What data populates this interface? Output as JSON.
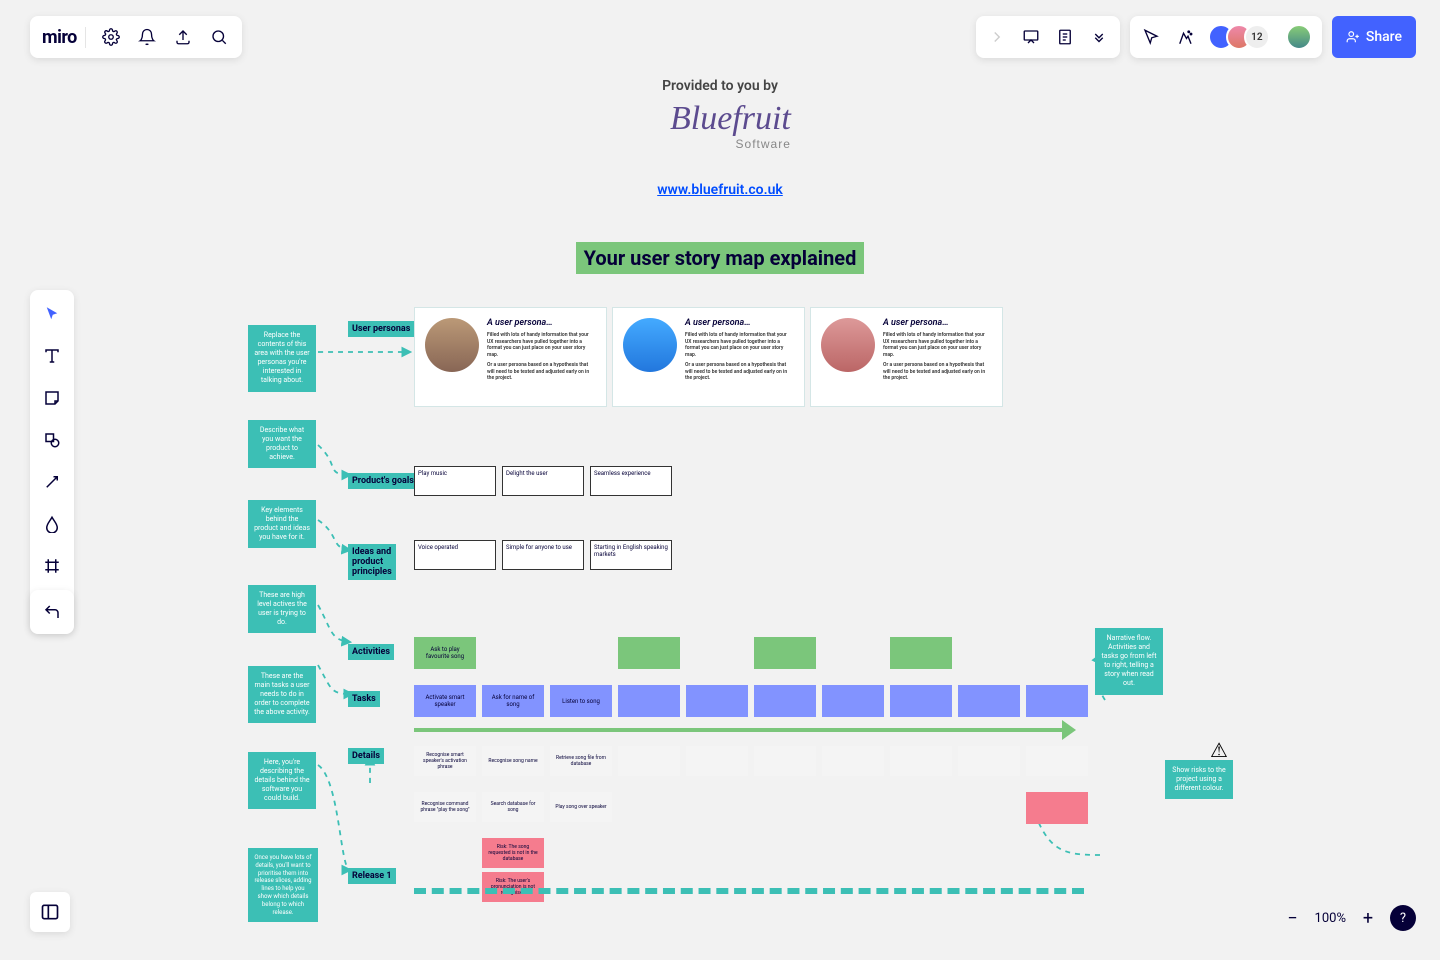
{
  "header": {
    "logo": "miro",
    "share_label": "Share",
    "overflow_count": "12"
  },
  "zoom": {
    "level": "100%"
  },
  "provided_by": "Provided to you by",
  "brand": {
    "name": "Bluefruit",
    "sub": "Software",
    "url": "www.bluefruit.co.uk"
  },
  "title": "Your user story map explained",
  "notes": {
    "personas_note": "Replace the contents of this area with the user personas you're interested in talking about.",
    "goals_note": "Describe what you want the product to achieve.",
    "principles_note": "Key elements behind the product and ideas you have for it.",
    "activities_note": "These are high level actives the user is trying to do.",
    "tasks_note": "These are the main tasks a user needs to do in order to complete the above activity.",
    "details_note": "Here, you're describing the details behind the software you could build.",
    "release_note": "Once you have lots of details, you'll want to prioritise them into release slices, adding lines to help you show which details belong to which release.",
    "narrative_note": "Narrative flow. Activities and tasks go from left to right, telling a story when read out.",
    "risks_note": "Show risks to the project using a different colour."
  },
  "labels": {
    "personas": "User personas",
    "goals": "Product's goals",
    "principles": "Ideas and product principles",
    "activities": "Activities",
    "tasks": "Tasks",
    "details": "Details",
    "release1": "Release 1"
  },
  "personas": [
    {
      "title": "A user persona…",
      "p1": "Filled with lots of handy information that your UX researchers have pulled together into a format you can just place on your user story map.",
      "p2": "Or a user persona based on a hypothesis that will need to be tested and adjusted early on in the project."
    },
    {
      "title": "A user persona…",
      "p1": "Filled with lots of handy information that your UX researchers have pulled together into a format you can just place on your user story map.",
      "p2": "Or a user persona based on a hypothesis that will need to be tested and adjusted early on in the project."
    },
    {
      "title": "A user persona…",
      "p1": "Filled with lots of handy information that your UX researchers have pulled together into a format you can just place on your user story map.",
      "p2": "Or a user persona based on a hypothesis that will need to be tested and adjusted early on in the project."
    }
  ],
  "goals": [
    "Play music",
    "Delight the user",
    "Seamless experience"
  ],
  "principles": [
    "Voice operated",
    "Simple for anyone to use",
    "Starting in English speaking markets"
  ],
  "activities": [
    "Ask to play favourite song"
  ],
  "tasks": [
    "Activate smart speaker",
    "Ask for name of song",
    "Listen to song"
  ],
  "details_row1": [
    "Recognise smart speaker's activation phrase",
    "Recognise song name",
    "Retrieve song file from database"
  ],
  "details_row2": [
    "Recognise command phrase \"play the song\"",
    "Search database for song",
    "Play song over speaker"
  ],
  "risks": [
    "Risk: The song requested is not in the database",
    "Risk: The user's pronunciation is not recognised"
  ]
}
